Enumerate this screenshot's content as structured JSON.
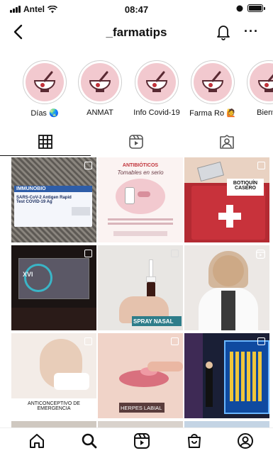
{
  "status_bar": {
    "carrier": "Antel",
    "time": "08:47"
  },
  "header": {
    "username": "_farmatips",
    "more_label": "···"
  },
  "highlights": [
    {
      "label": "Días 🌏"
    },
    {
      "label": "ANMAT"
    },
    {
      "label": "Info Covid-19"
    },
    {
      "label": "Farma Ro 🙋"
    },
    {
      "label": "Bienve"
    }
  ],
  "tabs": [
    {
      "name": "grid",
      "icon": "grid-icon",
      "active": true
    },
    {
      "name": "reels",
      "icon": "reels-icon",
      "active": false
    },
    {
      "name": "tagged",
      "icon": "tagged-icon",
      "active": false
    }
  ],
  "posts": [
    {
      "id": "p1",
      "title": "IMMUNOBIO",
      "subtitle": "SARS-CoV-2 Antigen Rapid Test COVID-19 Ag"
    },
    {
      "id": "p2",
      "title": "ANTIBIÓTICOS",
      "subtitle": "Tomables en serio"
    },
    {
      "id": "p3",
      "title": "BOTIQUÍN CASERO"
    },
    {
      "id": "p4",
      "title": "XVI"
    },
    {
      "id": "p5",
      "title": "SPRAY NASAL"
    },
    {
      "id": "p6",
      "title": ""
    },
    {
      "id": "p7",
      "title": "ANTICONCEPTIVO DE EMERGENCIA"
    },
    {
      "id": "p8",
      "title": "HERPES LABIAL"
    },
    {
      "id": "p9",
      "title": ""
    }
  ],
  "bottom_nav": [
    {
      "name": "home",
      "icon": "home-icon"
    },
    {
      "name": "search",
      "icon": "search-icon"
    },
    {
      "name": "reels",
      "icon": "reels-icon"
    },
    {
      "name": "shop",
      "icon": "shop-icon"
    },
    {
      "name": "profile",
      "icon": "profile-icon"
    }
  ],
  "colors": {
    "highlight_bg": "#f2c9cf",
    "accent": "#c0323a"
  }
}
